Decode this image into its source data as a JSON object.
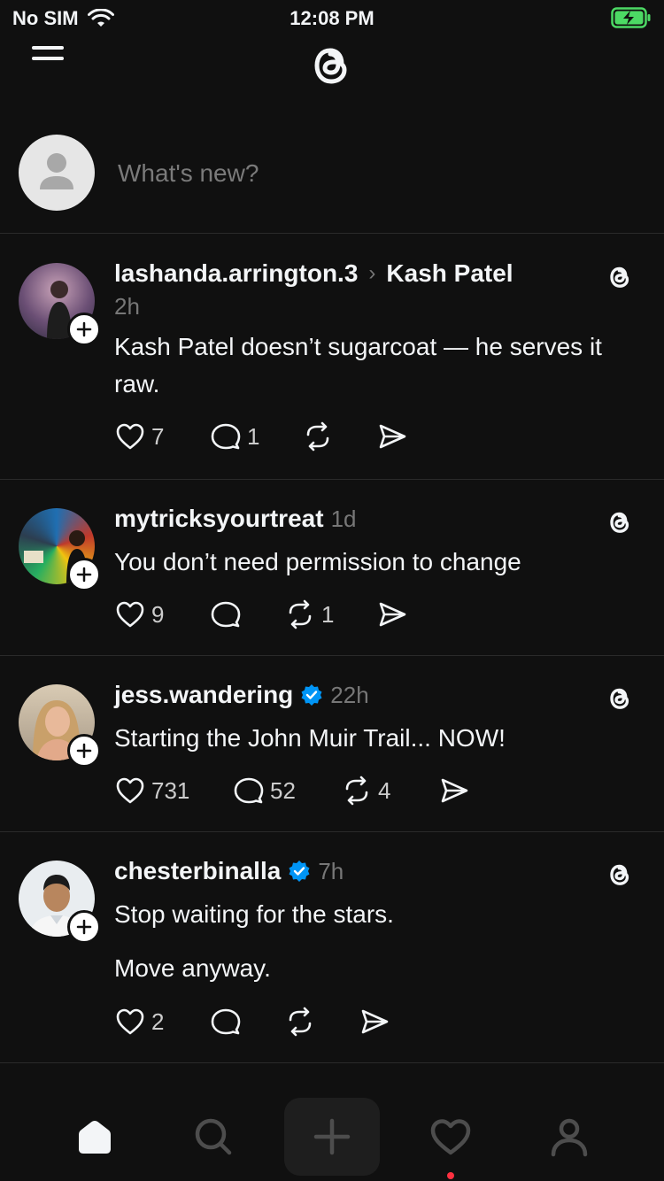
{
  "status": {
    "carrier": "No SIM",
    "time": "12:08 PM",
    "battery_color": "#4cd964"
  },
  "header": {
    "menu_icon": "menu-icon",
    "logo_icon": "threads-logo-icon"
  },
  "composer": {
    "placeholder": "What's new?"
  },
  "posts": [
    {
      "username": "lashanda.arrington.3",
      "reply_to": "Kash Patel",
      "time": "2h",
      "text": "Kash Patel doesn’t sugarcoat — he serves it raw.",
      "likes": "7",
      "replies": "1",
      "reposts": "",
      "verified": false
    },
    {
      "username": "mytricksyourtreat",
      "time": "1d",
      "text": "You don’t need permission to change",
      "likes": "9",
      "replies": "",
      "reposts": "1",
      "verified": false
    },
    {
      "username": "jess.wandering",
      "time": "22h",
      "text": "Starting the John Muir Trail... NOW!",
      "likes": "731",
      "replies": "52",
      "reposts": "4",
      "verified": true
    },
    {
      "username": "chesterbinalla",
      "time": "7h",
      "text": "Stop waiting for the stars.",
      "text2": "Move anyway.",
      "likes": "2",
      "replies": "",
      "reposts": "",
      "verified": true
    }
  ],
  "tabbar": {
    "items": [
      "home-icon",
      "search-icon",
      "plus-icon",
      "heart-icon",
      "profile-icon"
    ],
    "notification_color": "#ff3040"
  },
  "colors": {
    "background": "#101010",
    "verified": "#0095f6",
    "secondary_text": "#777777"
  }
}
